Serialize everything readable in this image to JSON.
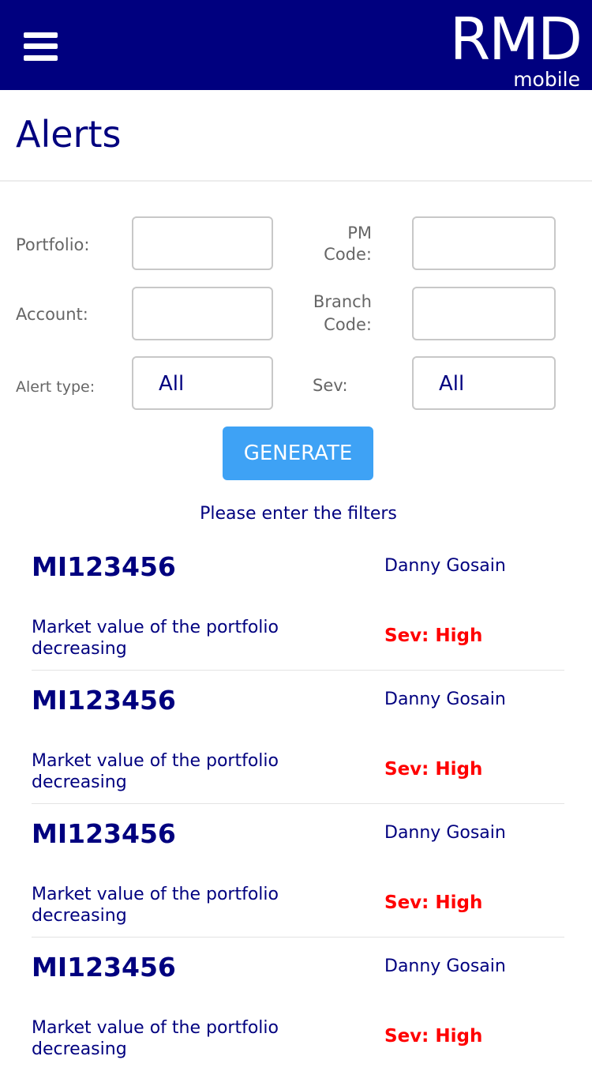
{
  "header": {
    "logo_main": "RMD",
    "logo_sub": "mobile",
    "bar_color": "#00007f",
    "menu_icon": "hamburger-menu-icon"
  },
  "page": {
    "title": "Alerts"
  },
  "filters": {
    "portfolio_label": "Portfolio:",
    "portfolio_value": "",
    "pm_code_label_1": "PM",
    "pm_code_label_2": "Code:",
    "pm_code_value": "",
    "account_label": "Account:",
    "account_value": "",
    "branch_code_label_1": "Branch",
    "branch_code_label_2": "Code:",
    "branch_code_value": "",
    "alert_type_label": "Alert type:",
    "alert_type_value": "All",
    "sev_label": "Sev:",
    "sev_value": "All"
  },
  "actions": {
    "generate_label": "GENERATE",
    "generate_color": "#3ea2f5"
  },
  "hint": "Please enter the filters",
  "alerts": [
    {
      "id": "MI123456",
      "name": "Danny Gosain",
      "message": "Market value of the portfolio decreasing",
      "severity": "Sev: High"
    },
    {
      "id": "MI123456",
      "name": "Danny Gosain",
      "message": "Market value of the portfolio decreasing",
      "severity": "Sev: High"
    },
    {
      "id": "MI123456",
      "name": "Danny Gosain",
      "message": "Market value of the portfolio decreasing",
      "severity": "Sev: High"
    },
    {
      "id": "MI123456",
      "name": "Danny Gosain",
      "message": "Market value of the portfolio decreasing",
      "severity": "Sev: High"
    }
  ],
  "colors": {
    "primary": "#00007f",
    "severity_high": "#ff0000"
  }
}
